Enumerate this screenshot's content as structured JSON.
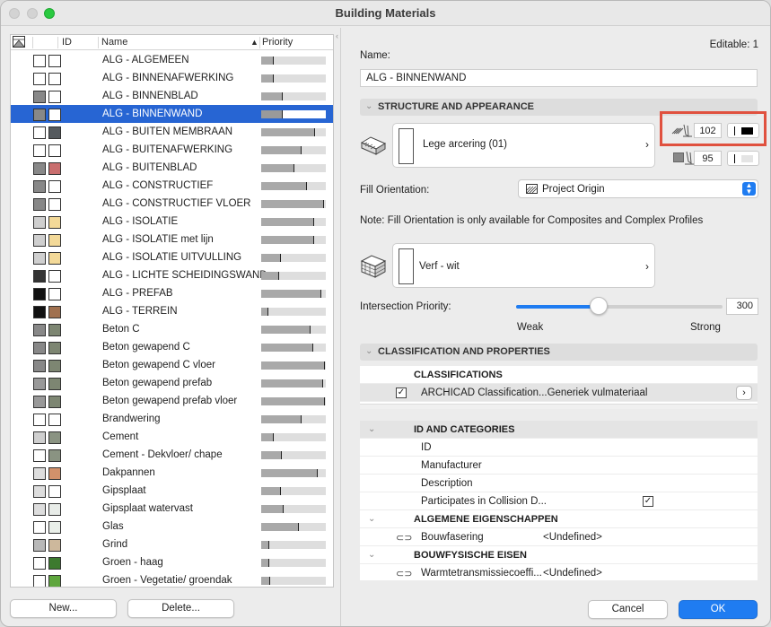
{
  "window": {
    "title": "Building Materials"
  },
  "list": {
    "headers": {
      "id": "ID",
      "name": "Name",
      "priority": "Priority"
    },
    "sort_indicator": "▲",
    "rows": [
      {
        "name": "ALG - ALGEMEEN",
        "priority": 0.2,
        "c1": "#ffffff",
        "c2": "#ffffff",
        "selected": false
      },
      {
        "name": "ALG - BINNENAFWERKING",
        "priority": 0.2,
        "c1": "#ffffff",
        "c2": "#ffffff",
        "selected": false
      },
      {
        "name": "ALG - BINNENBLAD",
        "priority": 0.33,
        "c1": "#888888",
        "c2": "#ffffff",
        "selected": false
      },
      {
        "name": "ALG - BINNENWAND",
        "priority": 0.33,
        "c1": "#888888",
        "c2": "#ffffff",
        "selected": true
      },
      {
        "name": "ALG - BUITEN MEMBRAAN",
        "priority": 0.84,
        "c1": "#ffffff",
        "c2": "#555a5e",
        "selected": false
      },
      {
        "name": "ALG - BUITENAFWERKING",
        "priority": 0.63,
        "c1": "#ffffff",
        "c2": "#ffffff",
        "selected": false
      },
      {
        "name": "ALG - BUITENBLAD",
        "priority": 0.52,
        "c1": "#888888",
        "c2": "#c96e6e",
        "selected": false
      },
      {
        "name": "ALG - CONSTRUCTIEF",
        "priority": 0.71,
        "c1": "#888888",
        "c2": "#ffffff",
        "selected": false
      },
      {
        "name": "ALG - CONSTRUCTIEF VLOER",
        "priority": 0.97,
        "c1": "#888888",
        "c2": "#ffffff",
        "selected": false
      },
      {
        "name": "ALG - ISOLATIE",
        "priority": 0.82,
        "c1": "#cfcfcf",
        "c2": "#f3d998",
        "selected": false
      },
      {
        "name": "ALG - ISOLATIE met lijn",
        "priority": 0.82,
        "c1": "#cfcfcf",
        "c2": "#f3d998",
        "selected": false
      },
      {
        "name": "ALG - ISOLATIE UITVULLING",
        "priority": 0.3,
        "c1": "#cfcfcf",
        "c2": "#f3d998",
        "selected": false
      },
      {
        "name": "ALG - LICHTE SCHEIDINGSWAND",
        "priority": 0.28,
        "c1": "#333333",
        "c2": "#ffffff",
        "selected": false
      },
      {
        "name": "ALG - PREFAB",
        "priority": 0.93,
        "c1": "#111111",
        "c2": "#ffffff",
        "selected": false
      },
      {
        "name": "ALG - TERREIN",
        "priority": 0.11,
        "c1": "#111111",
        "c2": "#a0704f",
        "selected": false
      },
      {
        "name": "Beton C",
        "priority": 0.77,
        "c1": "#888888",
        "c2": "#7d8672",
        "selected": false
      },
      {
        "name": "Beton gewapend C",
        "priority": 0.8,
        "c1": "#888888",
        "c2": "#7d8672",
        "selected": false
      },
      {
        "name": "Beton gewapend C vloer",
        "priority": 0.98,
        "c1": "#888888",
        "c2": "#7d8672",
        "selected": false
      },
      {
        "name": "Beton gewapend prefab",
        "priority": 0.96,
        "c1": "#999999",
        "c2": "#7d8672",
        "selected": false
      },
      {
        "name": "Beton gewapend prefab vloer",
        "priority": 0.98,
        "c1": "#999999",
        "c2": "#7d8672",
        "selected": false
      },
      {
        "name": "Brandwering",
        "priority": 0.63,
        "c1": "#ffffff",
        "c2": "#ffffff",
        "selected": false
      },
      {
        "name": "Cement",
        "priority": 0.19,
        "c1": "#cfcfcf",
        "c2": "#8a9382",
        "selected": false
      },
      {
        "name": "Cement - Dekvloer/ chape",
        "priority": 0.32,
        "c1": "#ffffff",
        "c2": "#8a9382",
        "selected": false
      },
      {
        "name": "Dakpannen",
        "priority": 0.88,
        "c1": "#dddddd",
        "c2": "#d2916b",
        "selected": false
      },
      {
        "name": "Gipsplaat",
        "priority": 0.31,
        "c1": "#dddddd",
        "c2": "#ffffff",
        "selected": false
      },
      {
        "name": "Gipsplaat watervast",
        "priority": 0.35,
        "c1": "#dddddd",
        "c2": "#e8ece8",
        "selected": false
      },
      {
        "name": "Glas",
        "priority": 0.58,
        "c1": "#ffffff",
        "c2": "#e9efe9",
        "selected": false
      },
      {
        "name": "Grind",
        "priority": 0.13,
        "c1": "#b8b8b8",
        "c2": "#cdb89c",
        "selected": false
      },
      {
        "name": "Groen - haag",
        "priority": 0.13,
        "c1": "#ffffff",
        "c2": "#3d7a2f",
        "selected": false
      },
      {
        "name": "Groen - Vegetatie/ groendak",
        "priority": 0.14,
        "c1": "#ffffff",
        "c2": "#5ea63d",
        "selected": false
      }
    ]
  },
  "buttons": {
    "new": "New...",
    "delete": "Delete...",
    "cancel": "Cancel",
    "ok": "OK"
  },
  "details": {
    "editable": "Editable: 1",
    "name_label": "Name:",
    "name_value": "ALG - BINNENWAND",
    "structure_section": "STRUCTURE AND APPEARANCE",
    "cut_fill": "Lege arcering (01)",
    "cut_fill_pen": "102",
    "bg_pen": "95",
    "fill_orientation_label": "Fill Orientation:",
    "fill_orientation_value": "Project Origin",
    "note": "Note: Fill Orientation is only available for Composites and Complex Profiles",
    "surface": "Verf - wit",
    "intersection_label": "Intersection Priority:",
    "intersection_value": "300",
    "intersection_fraction": 0.4,
    "weak": "Weak",
    "strong": "Strong",
    "classification_section": "CLASSIFICATION AND PROPERTIES",
    "classifications_head": "CLASSIFICATIONS",
    "classification_item": "ARCHICAD Classification...Generiek vulmateriaal",
    "id_categories_head": "ID AND CATEGORIES",
    "id_label": "ID",
    "manufacturer_label": "Manufacturer",
    "description_label": "Description",
    "collision_label": "Participates in Collision D...",
    "general_head": "ALGEMENE EIGENSCHAPPEN",
    "bouwfasering_label": "Bouwfasering",
    "undefined1": "<Undefined>",
    "physical_head": "BOUWFYSISCHE EISEN",
    "warmte_label": "Warmtetransmissiecoeffi...",
    "undefined2": "<Undefined>"
  }
}
